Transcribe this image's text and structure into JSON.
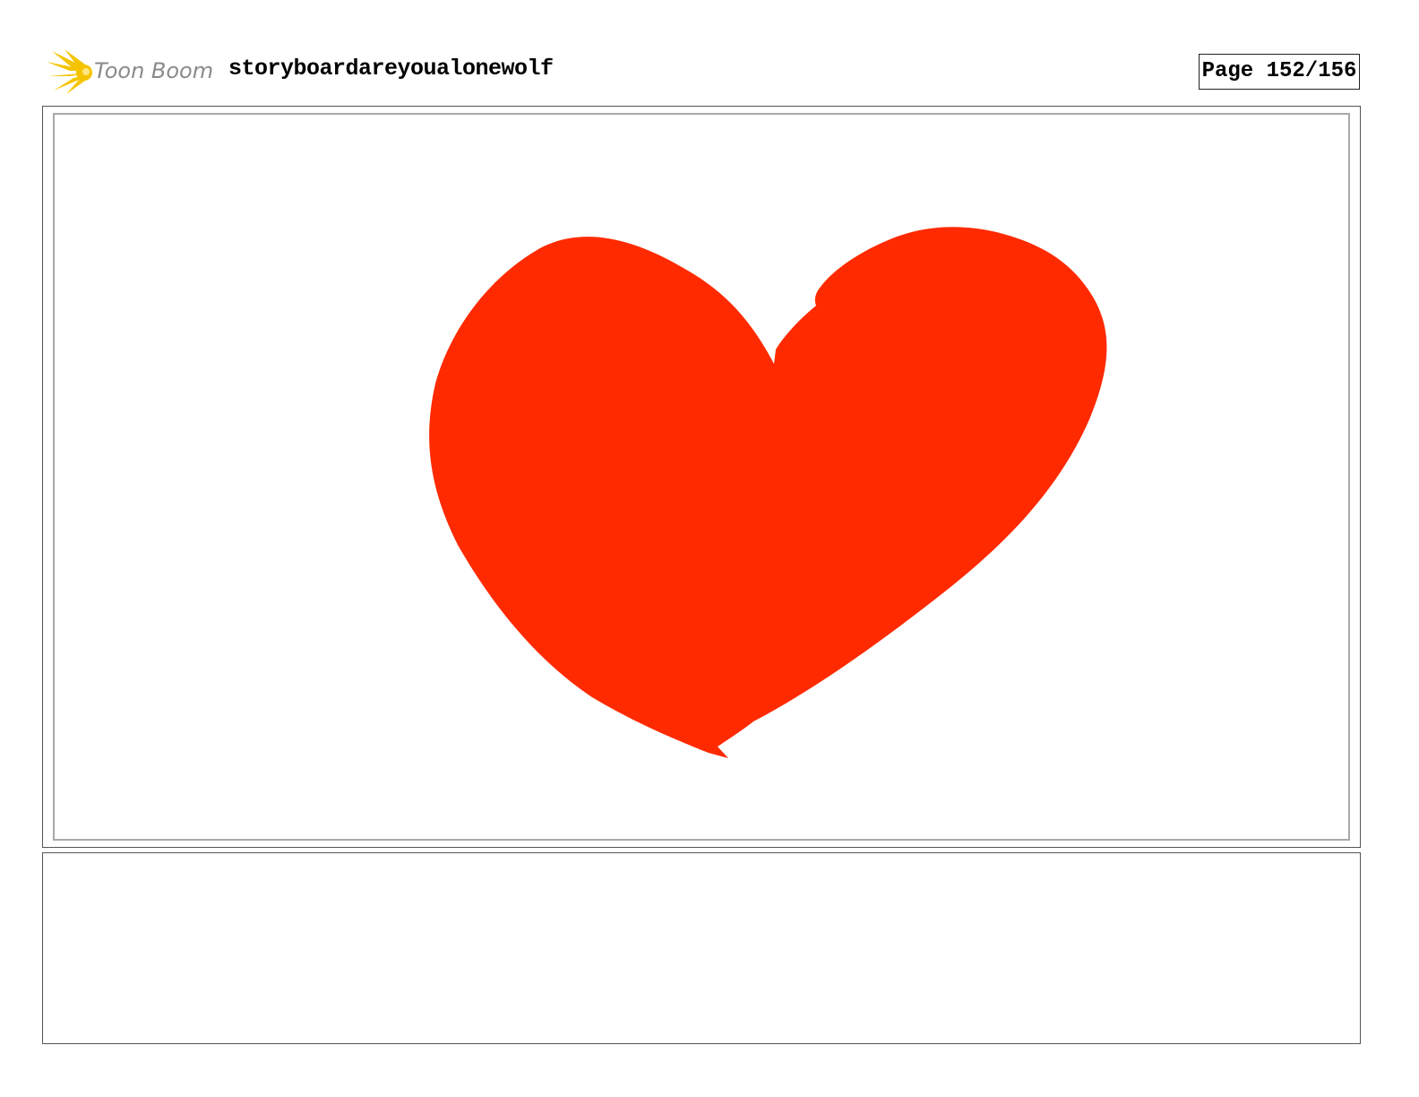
{
  "header": {
    "logo_text": "Toon Boom",
    "logo_icon": "toon-boom-burst-icon",
    "title": "storyboardareyoualonewolf",
    "page_label": "Page 152/156"
  },
  "panel": {
    "drawing": "heart-drawing",
    "heart_color": "#ff2a00"
  },
  "colors": {
    "logo_burst": "#f5c400",
    "border": "#555555",
    "inner_border": "#a9a9a9"
  }
}
